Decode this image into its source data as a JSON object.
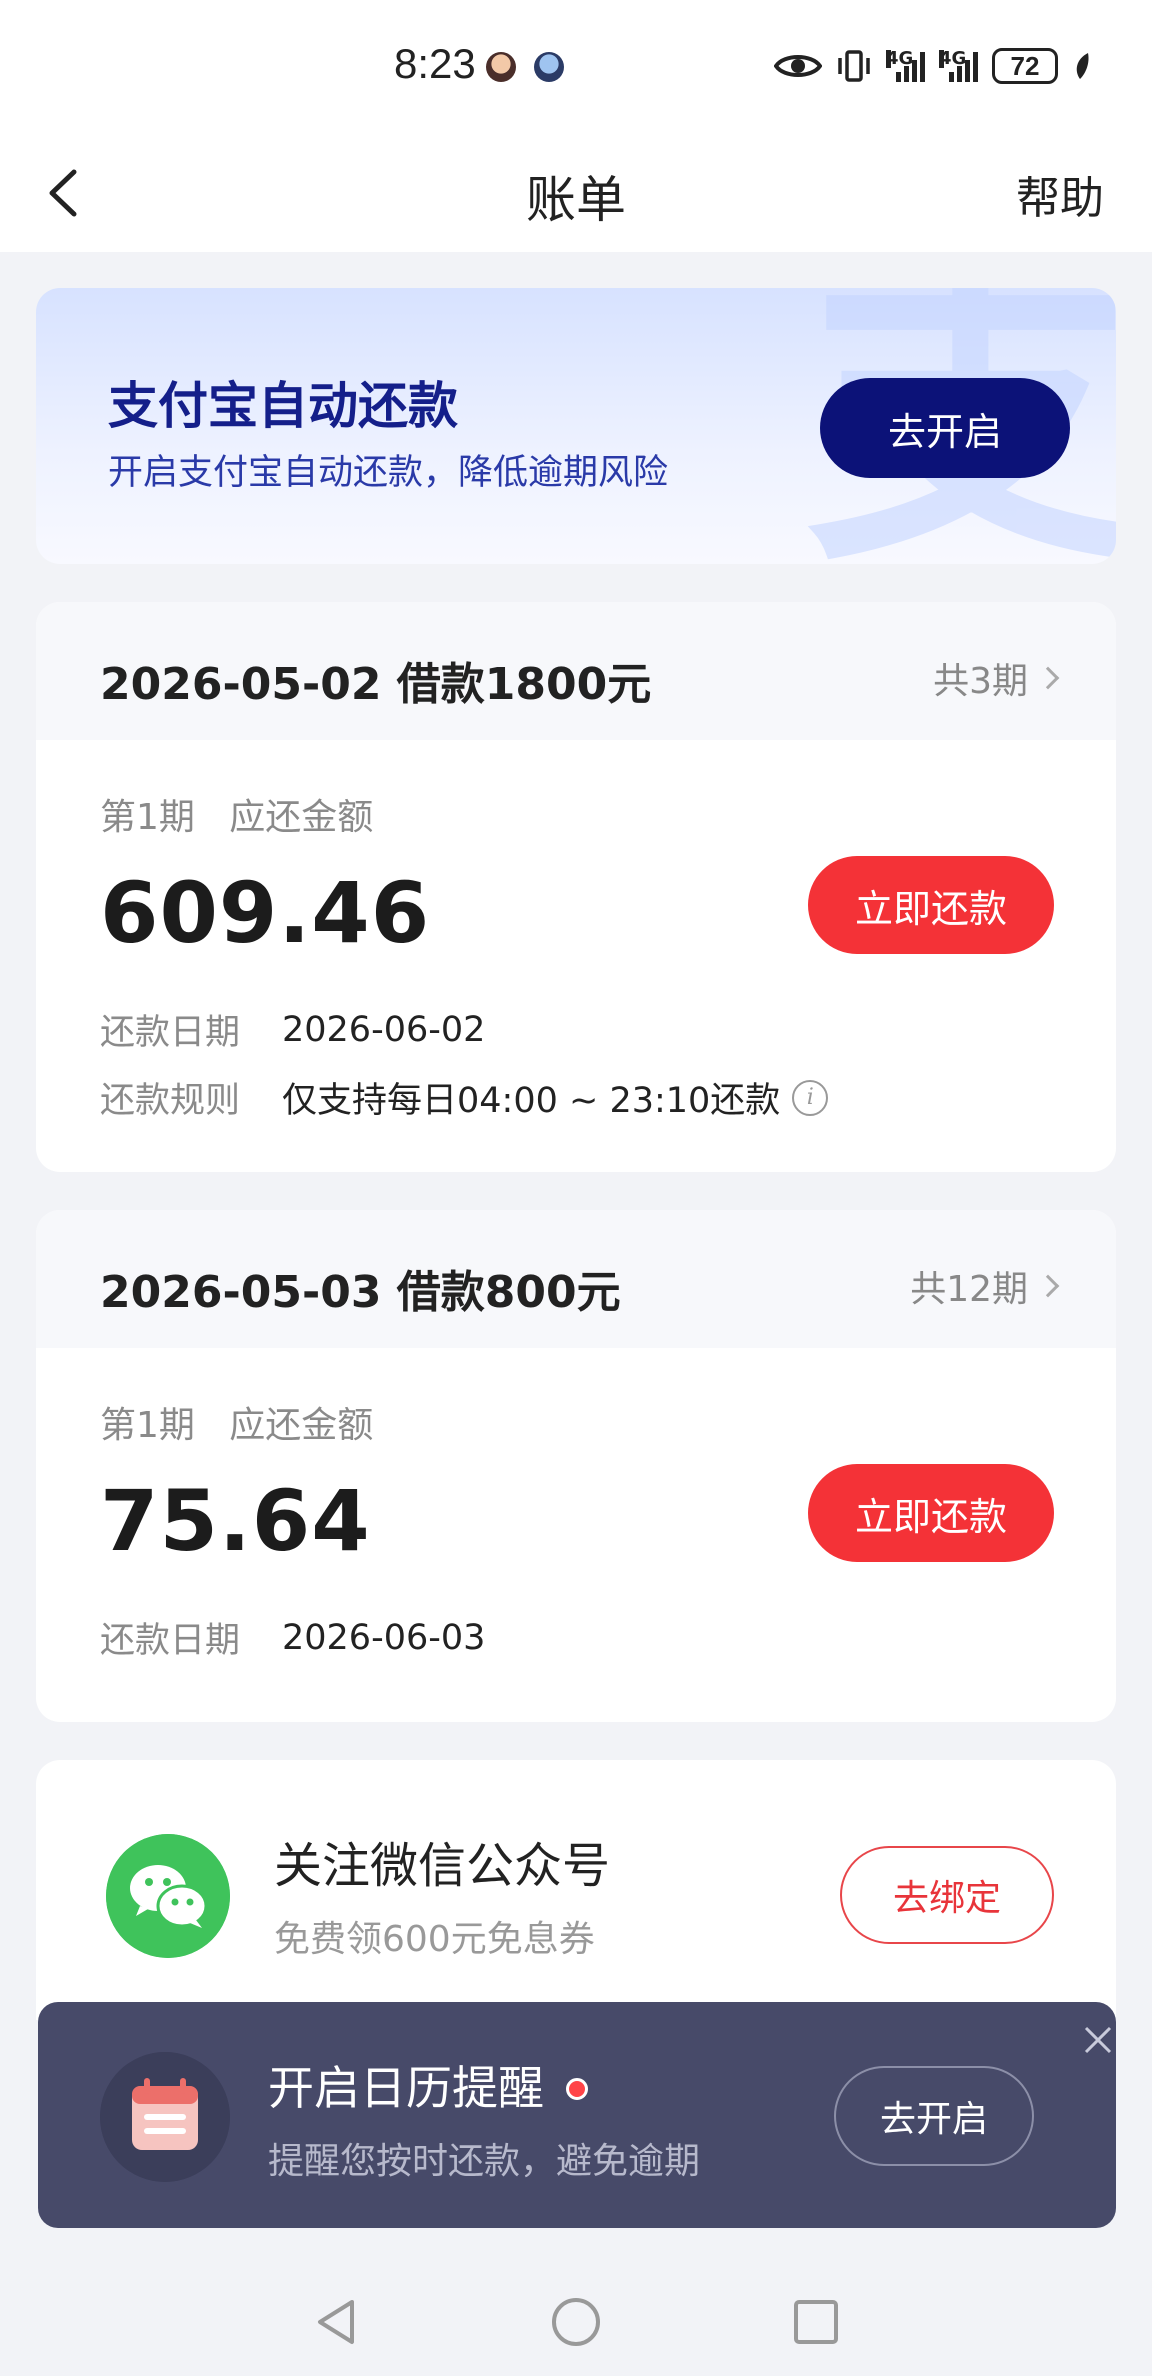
{
  "status_bar": {
    "time": "8:23",
    "network_1": "4G",
    "network_2": "4G",
    "battery": "72"
  },
  "header": {
    "title": "账单",
    "help": "帮助"
  },
  "alipay": {
    "title": "支付宝自动还款",
    "subtitle": "开启支付宝自动还款，降低逾期风险",
    "button": "去开启",
    "watermark": "支"
  },
  "loans": [
    {
      "title": "2026-05-02 借款1800元",
      "periods": "共3期",
      "period_label": "第1期",
      "amount_label": "应还金额",
      "amount": "609.46",
      "button": "立即还款",
      "due_date_label": "还款日期",
      "due_date": "2026-06-02",
      "rule_label": "还款规则",
      "rule": "仅支持每日04:00 ~ 23:10还款"
    },
    {
      "title": "2026-05-03 借款800元",
      "periods": "共12期",
      "period_label": "第1期",
      "amount_label": "应还金额",
      "amount": "75.64",
      "button": "立即还款",
      "due_date_label": "还款日期",
      "due_date": "2026-06-03"
    }
  ],
  "wechat": {
    "title": "关注微信公众号",
    "subtitle": "免费领600元免息券",
    "button": "去绑定"
  },
  "calendar": {
    "title": "开启日历提醒",
    "subtitle": "提醒您按时还款，避免逾期",
    "button": "去开启"
  },
  "colors": {
    "accent_red": "#f43237",
    "alipay_blue": "#0c1278",
    "banner_bg": "#474a69",
    "wechat_green": "#3fc35b"
  },
  "icons": [
    "back-arrow-icon",
    "eye-icon",
    "vibrate-icon",
    "signal-icon",
    "battery-icon",
    "chevron-right-icon",
    "info-icon",
    "wechat-icon",
    "calendar-icon",
    "close-icon",
    "nav-back-icon",
    "nav-home-icon",
    "nav-recents-icon"
  ]
}
